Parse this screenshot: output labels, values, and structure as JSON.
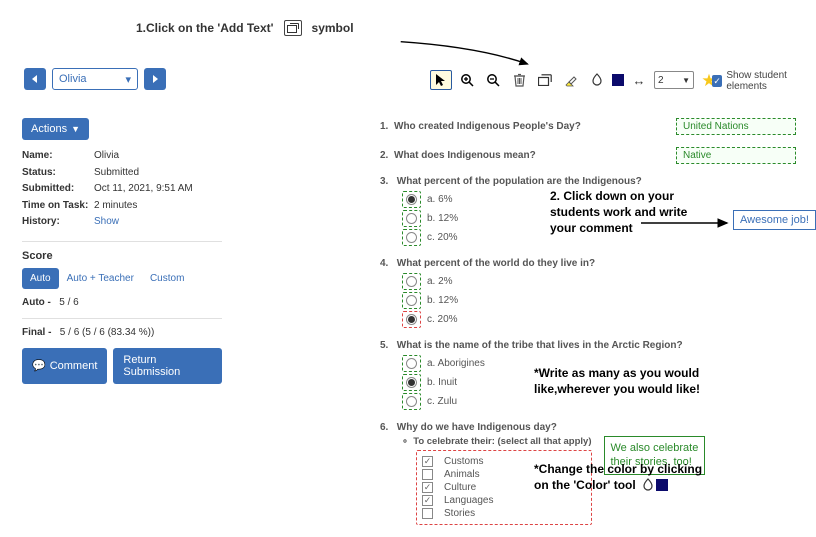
{
  "instruction1_a": "1.Click on the 'Add Text'",
  "instruction1_b": "symbol",
  "nav": {
    "student": "Olivia"
  },
  "toolbar": {
    "width_value": "2",
    "show_label": "Show student elements"
  },
  "sidebar": {
    "actions": "Actions",
    "meta": {
      "name_l": "Name:",
      "name_v": "Olivia",
      "status_l": "Status:",
      "status_v": "Submitted",
      "submitted_l": "Submitted:",
      "submitted_v": "Oct 11, 2021, 9:51 AM",
      "tot_l": "Time on Task:",
      "tot_v": "2 minutes",
      "history_l": "History:",
      "history_v": "Show"
    },
    "score_heading": "Score",
    "tabs": {
      "auto": "Auto",
      "auto_teacher": "Auto + Teacher",
      "custom": "Custom"
    },
    "auto_line_l": "Auto -",
    "auto_line_v": "5 / 6",
    "final_line_l": "Final -",
    "final_line_v": "5 / 6  (5 / 6 (83.34 %))",
    "comment_btn": "Comment",
    "return_btn": "Return Submission"
  },
  "questions": {
    "q1_n": "1.",
    "q1_p": "Who created Indigenous People's Day?",
    "q1_a": "United Nations",
    "q2_n": "2.",
    "q2_p": "What does Indigenous mean?",
    "q2_a": "Native",
    "q3_n": "3.",
    "q3_p": "What percent of the population are the Indigenous?",
    "q3_a": "a.  6%",
    "q3_b": "b.  12%",
    "q3_c": "c.  20%",
    "q4_n": "4.",
    "q4_p": "What percent of the world do they live in?",
    "q4_a": "a.  2%",
    "q4_b": "b.  12%",
    "q4_c": "c.  20%",
    "q5_n": "5.",
    "q5_p": "What is the name of the tribe that lives in the Arctic Region?",
    "q5_a": "a.  Aborigines",
    "q5_b": "b.  Inuit",
    "q5_c": "c.  Zulu",
    "q6_n": "6.",
    "q6_p": "Why do we have Indigenous day?",
    "q6_sub": "To celebrate their: (select all that apply)",
    "q6_1": "Customs",
    "q6_2": "Animals",
    "q6_3": "Culture",
    "q6_4": "Languages",
    "q6_5": "Stories"
  },
  "annotations": {
    "click2_a": "2. Click down on your",
    "click2_b": "students work and write",
    "click2_c": "your comment",
    "awesome": "Awesome job!",
    "write_many_a": "*Write as many as you would",
    "write_many_b": "like,wherever you would like!",
    "celebrate_a": "We also celebrate",
    "celebrate_b": "their stories, too!",
    "change_color_a": "*Change the color by clicking",
    "change_color_b": "on the 'Color' tool"
  }
}
